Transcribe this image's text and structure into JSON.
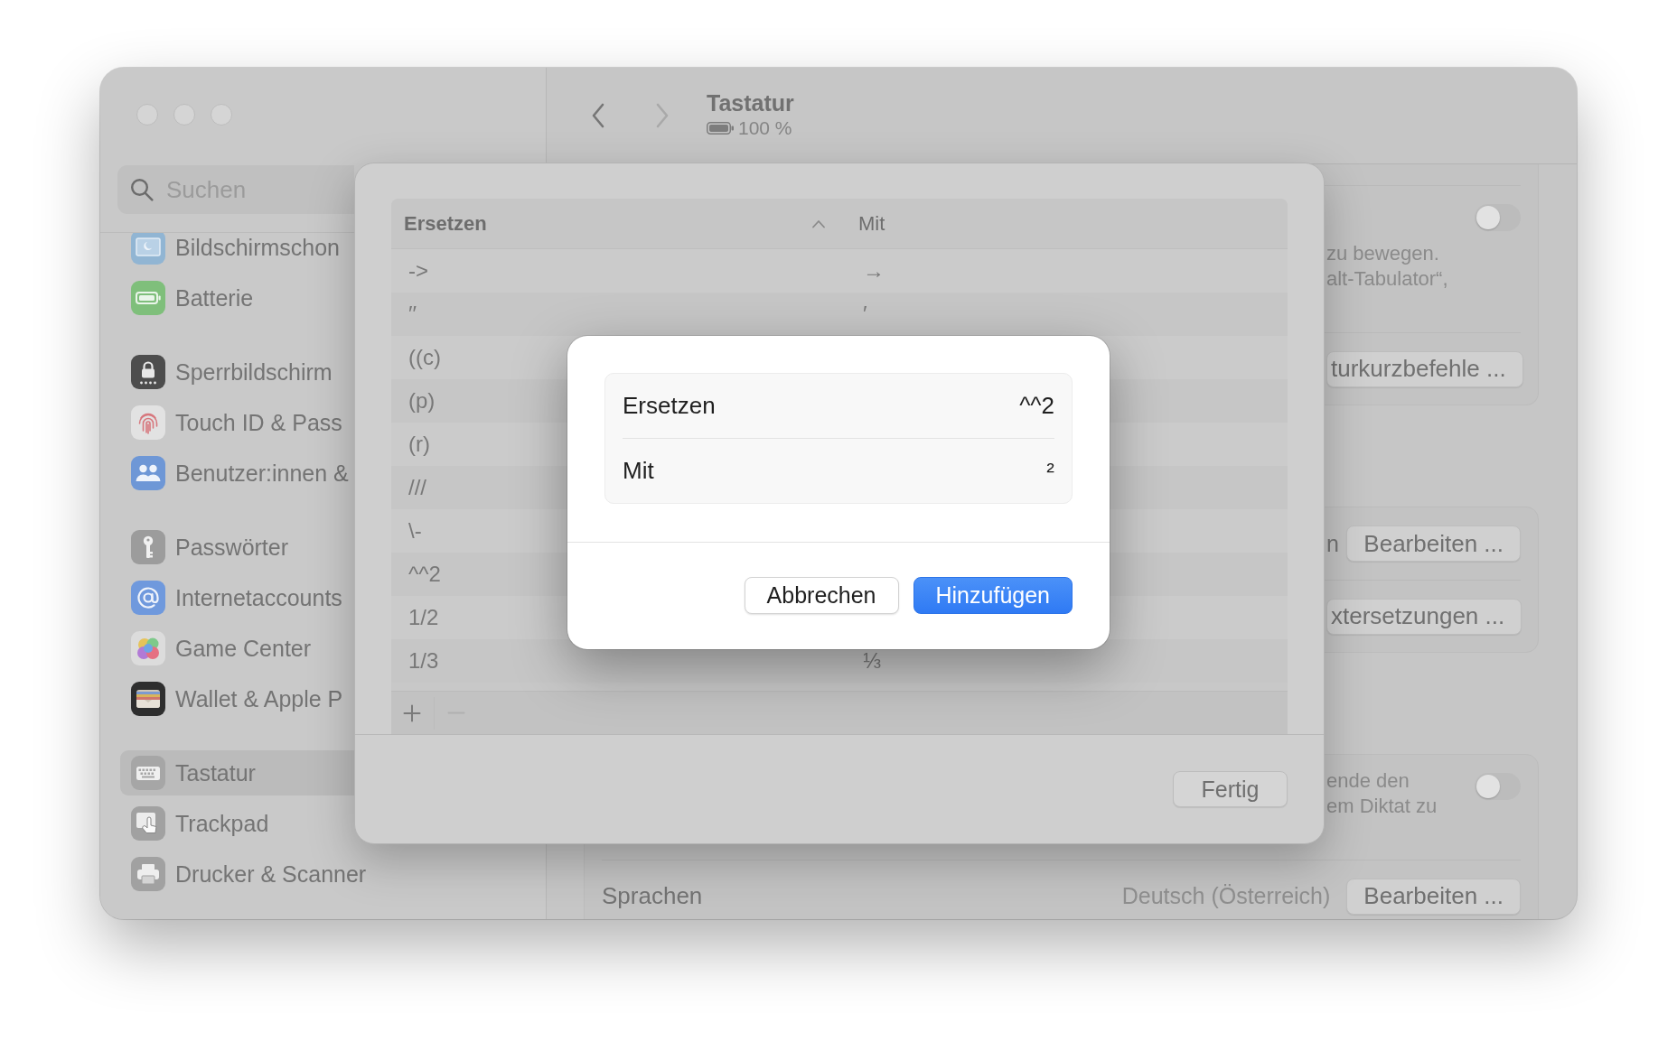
{
  "sidebar": {
    "search": {
      "placeholder": "Suchen"
    },
    "groups": [
      {
        "items": [
          {
            "label": "Bildschirmschon",
            "selected": false
          },
          {
            "label": "Batterie",
            "selected": false
          }
        ]
      },
      {
        "items": [
          {
            "label": "Sperrbildschirm",
            "selected": false
          },
          {
            "label": "Touch ID & Pass",
            "selected": false
          },
          {
            "label": "Benutzer:innen &",
            "selected": false
          }
        ]
      },
      {
        "items": [
          {
            "label": "Passwörter",
            "selected": false
          },
          {
            "label": "Internetaccounts",
            "selected": false
          },
          {
            "label": "Game Center",
            "selected": false
          },
          {
            "label": "Wallet & Apple P",
            "selected": false
          }
        ]
      },
      {
        "items": [
          {
            "label": "Tastatur",
            "selected": true
          },
          {
            "label": "Trackpad",
            "selected": false
          },
          {
            "label": "Drucker & Scanner",
            "selected": false
          }
        ]
      }
    ]
  },
  "toolbar": {
    "back": {
      "disabled": false
    },
    "forward": {
      "disabled": true
    },
    "title": "Tastatur",
    "battery": "100 %"
  },
  "content": {
    "cards": [
      {
        "rows": [
          {
            "kind": "toggle",
            "lines": [
              "zu bewegen.",
              "alt-Tabulator“,"
            ],
            "on": false
          },
          {
            "kind": "button",
            "button": "turkurzbefehle ..."
          }
        ]
      },
      {
        "rows": [
          {
            "kind": "button",
            "label": "n",
            "button": "Bearbeiten ..."
          },
          {
            "kind": "button",
            "button": "xtersetzungen ..."
          }
        ]
      },
      {
        "rows": [
          {
            "kind": "toggle",
            "lines": [
              "ende den",
              "em Diktat zu"
            ],
            "on": false
          },
          {
            "kind": "choice",
            "label": "Sprachen",
            "value": "Deutsch (Österreich)",
            "button": "Bearbeiten ..."
          }
        ]
      }
    ]
  },
  "sheet": {
    "table": {
      "columns": [
        {
          "label": "Ersetzen",
          "sorted": true
        },
        {
          "label": "Mit",
          "sorted": false
        }
      ],
      "rows": [
        {
          "replace": "->",
          "with": "→"
        },
        {
          "replace": "′′",
          "with": "′"
        },
        {
          "replace": "((c)"
        },
        {
          "replace": "(p)"
        },
        {
          "replace": "(r)"
        },
        {
          "replace": "///"
        },
        {
          "replace": "\\-"
        },
        {
          "replace": "^^2"
        },
        {
          "replace": "1/2"
        },
        {
          "replace": "1/3",
          "with": "⅓"
        }
      ],
      "add_button": {
        "disabled": false
      },
      "remove_button": {
        "disabled": true
      }
    },
    "done_button": "Fertig"
  },
  "dialog": {
    "fields": [
      {
        "label": "Ersetzen",
        "value": "^^2"
      },
      {
        "label": "Mit",
        "value": "²"
      }
    ],
    "buttons": [
      {
        "label": "Abbrechen",
        "kind": "cancel"
      },
      {
        "label": "Hinzufügen",
        "kind": "primary"
      }
    ]
  }
}
